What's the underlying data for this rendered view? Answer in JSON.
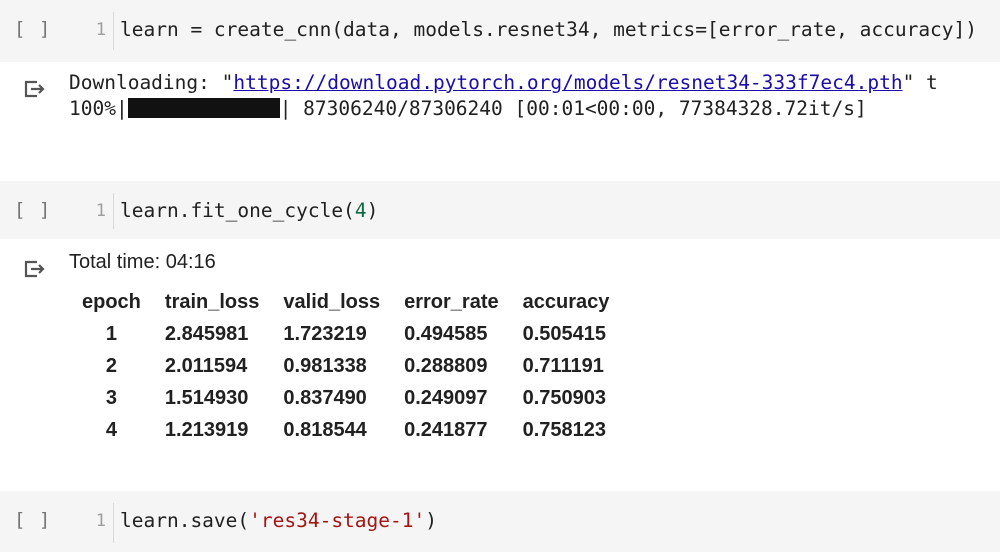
{
  "cells": [
    {
      "run_indicator": "[ ]",
      "line_number": "1",
      "code": {
        "before": "learn = create_cnn(data, models.resnet34, metrics=[error_rate, accuracy])"
      },
      "output": {
        "download_prefix": "Downloading: \"",
        "download_url": "https://download.pytorch.org/models/resnet34-333f7ec4.pth",
        "download_suffix": "\" t",
        "progress_percent": "100%|",
        "progress_value": 1.0,
        "progress_rest": "| 87306240/87306240 [00:01<00:00, 77384328.72it/s]"
      }
    },
    {
      "run_indicator": "[ ]",
      "line_number": "1",
      "code": {
        "before": "learn.fit_one_cycle(",
        "arg": "4",
        "after": ")"
      },
      "output": {
        "total_time": "Total time: 04:16",
        "table": {
          "headers": [
            "epoch",
            "train_loss",
            "valid_loss",
            "error_rate",
            "accuracy"
          ],
          "rows": [
            [
              "1",
              "2.845981",
              "1.723219",
              "0.494585",
              "0.505415"
            ],
            [
              "2",
              "2.011594",
              "0.981338",
              "0.288809",
              "0.711191"
            ],
            [
              "3",
              "1.514930",
              "0.837490",
              "0.249097",
              "0.750903"
            ],
            [
              "4",
              "1.213919",
              "0.818544",
              "0.241877",
              "0.758123"
            ]
          ]
        }
      }
    },
    {
      "run_indicator": "[ ]",
      "line_number": "1",
      "code": {
        "before": "learn.save(",
        "arg": "'res34-stage-1'",
        "after": ")"
      }
    }
  ],
  "colors": {
    "cell_background": "#f5f5f5",
    "link": "#1a0dab",
    "number_literal": "#116644",
    "string_literal": "#a31515"
  },
  "icons": {
    "output": "output-arrow-icon"
  }
}
